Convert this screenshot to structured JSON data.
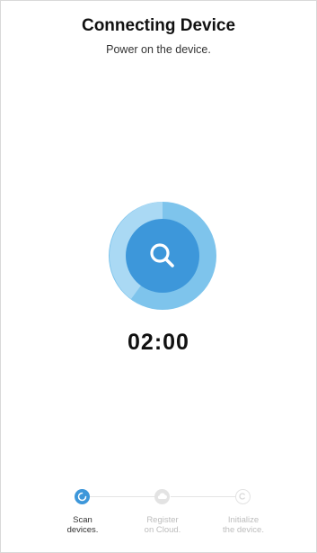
{
  "header": {
    "title": "Connecting Device",
    "subtitle": "Power on the device."
  },
  "scanner": {
    "icon": "search-icon",
    "progress_fraction": 0.1,
    "outer_color": "#7ec4ec",
    "inner_color": "#3d97da"
  },
  "timer": {
    "value": "02:00"
  },
  "steps": [
    {
      "line1": "Scan",
      "line2": "devices.",
      "state": "active",
      "icon": "loading-icon"
    },
    {
      "line1": "Register",
      "line2": "on Cloud.",
      "state": "pending",
      "icon": "cloud-icon"
    },
    {
      "line1": "Initialize",
      "line2": "the device.",
      "state": "pending",
      "icon": "copyright-icon"
    }
  ],
  "colors": {
    "accent": "#3d97da",
    "inactive": "#e3e3e3",
    "inactive_text": "#bdbdbd"
  }
}
